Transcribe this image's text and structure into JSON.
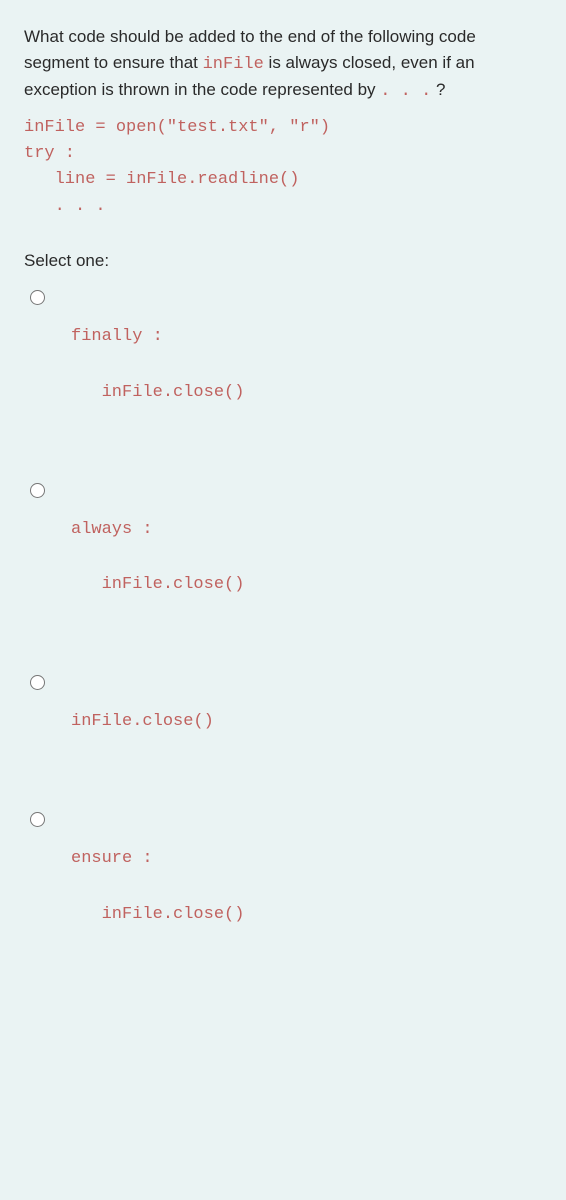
{
  "question": {
    "prefix1": "What code should be added to the end of the following code segment to ensure that ",
    "inlineCode": "inFile",
    "prefix2": " is always closed, even if an exception is thrown in the code represented by ",
    "dots": ". . .",
    "suffix": " ?"
  },
  "codeBlock": "inFile = open(\"test.txt\", \"r\")\ntry :\n   line = inFile.readline()\n   . . .",
  "selectOne": "Select one:",
  "options": [
    {
      "line1": "finally :",
      "line2": "   inFile.close()"
    },
    {
      "line1": "always :",
      "line2": "   inFile.close()"
    },
    {
      "line1": "inFile.close()",
      "line2": ""
    },
    {
      "line1": "ensure :",
      "line2": "   inFile.close()"
    }
  ]
}
